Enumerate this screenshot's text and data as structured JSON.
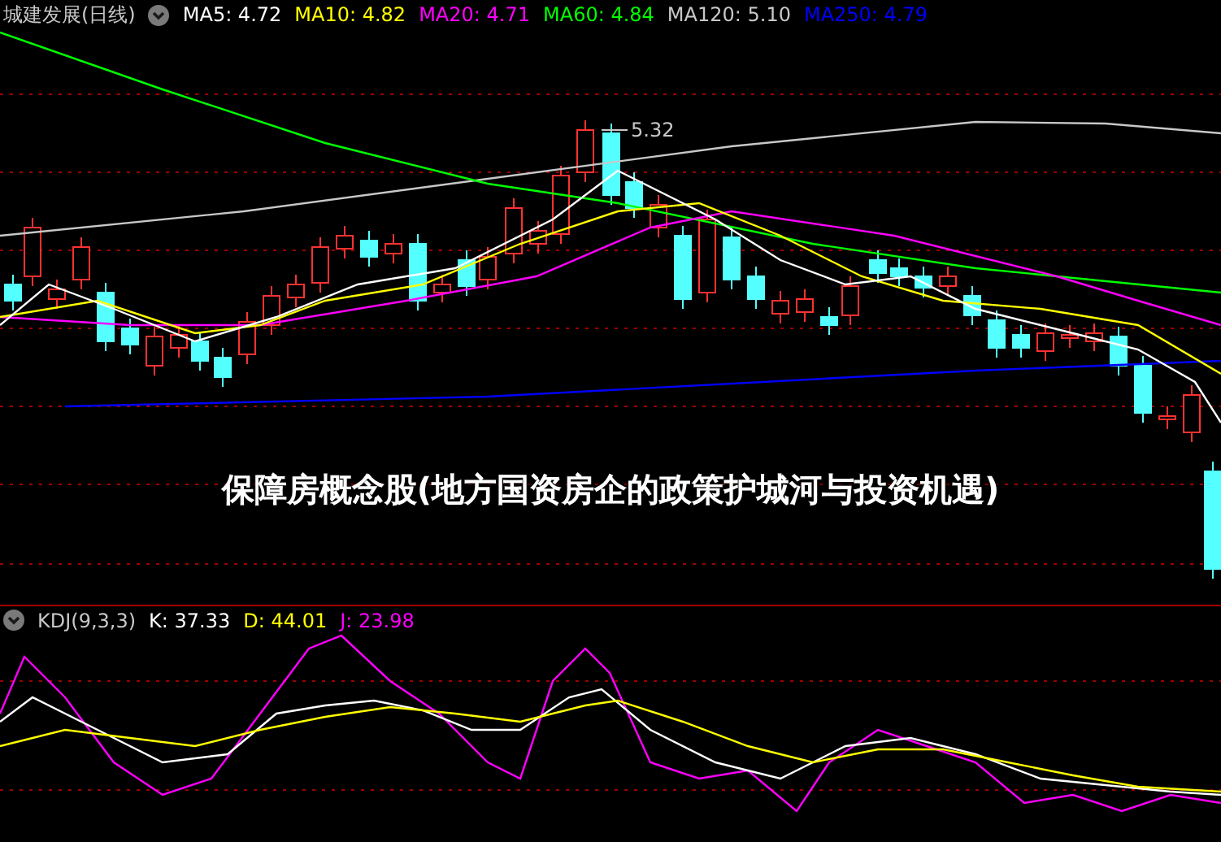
{
  "header": {
    "title": "城建发展(日线)",
    "indicators": [
      {
        "label": "MA5: 4.72",
        "color": "#ffffff"
      },
      {
        "label": "MA10: 4.82",
        "color": "#ffff00"
      },
      {
        "label": "MA20: 4.71",
        "color": "#ff00ff"
      },
      {
        "label": "MA60: 4.84",
        "color": "#00ff00"
      },
      {
        "label": "MA120: 5.10",
        "color": "#c8c8c8"
      },
      {
        "label": "MA250: 4.79",
        "color": "#0000ff"
      }
    ]
  },
  "price_chart": {
    "high_marker": "5.32"
  },
  "overlay_title": "保障房概念股(地方国资房企的政策护城河与投资机遇)",
  "kdj": {
    "title": "KDJ(9,3,3)",
    "values": [
      {
        "label": "K: 37.33",
        "color": "#ffffff"
      },
      {
        "label": "D: 44.01",
        "color": "#ffff00"
      },
      {
        "label": "J: 23.98",
        "color": "#ff00ff"
      }
    ]
  }
}
